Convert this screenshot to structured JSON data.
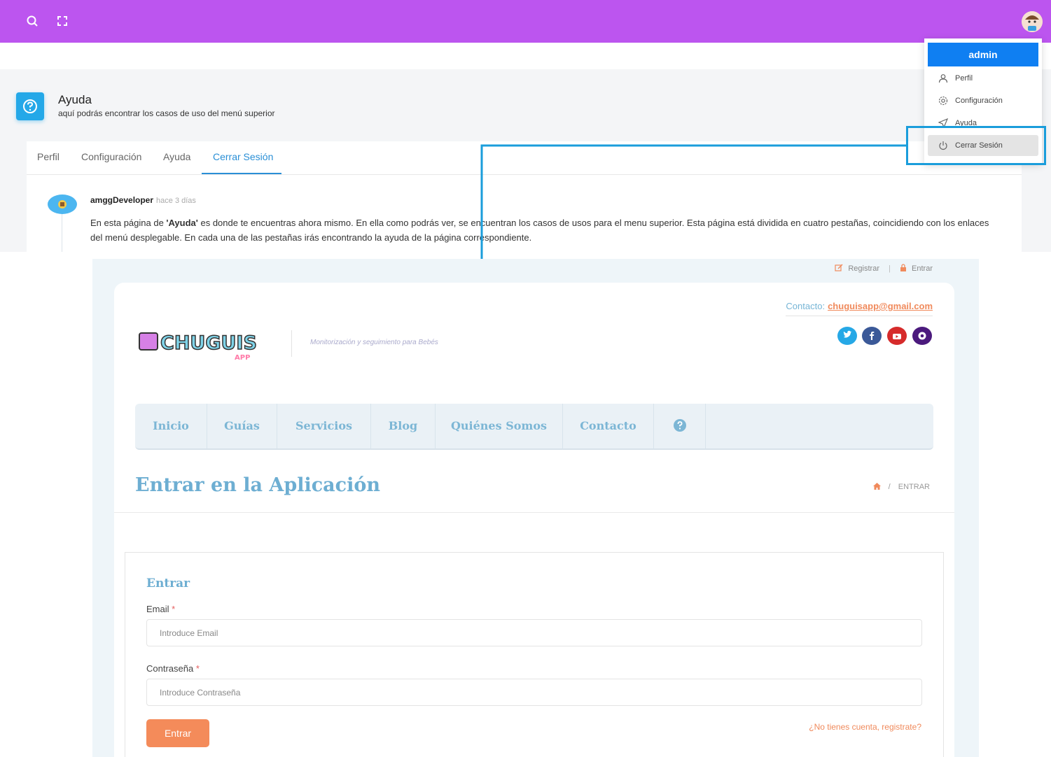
{
  "topbar": {
    "color": "#bc55ef"
  },
  "dropdown": {
    "header": "admin",
    "items": [
      {
        "label": "Perfil",
        "icon": "user-icon"
      },
      {
        "label": "Configuración",
        "icon": "gear-icon"
      },
      {
        "label": "Ayuda",
        "icon": "send-icon"
      },
      {
        "label": "Cerrar Sesión",
        "icon": "power-icon"
      }
    ]
  },
  "help": {
    "title": "Ayuda",
    "subtitle": "aquí podrás encontrar los casos de uso del menú superior"
  },
  "tabs": [
    {
      "label": "Perfil"
    },
    {
      "label": "Configuración"
    },
    {
      "label": "Ayuda"
    },
    {
      "label": "Cerrar Sesión"
    }
  ],
  "timeline": {
    "author": "amggDeveloper",
    "time": "hace 3 días",
    "text_pre": "En esta página de ",
    "text_bold": "'Ayuda'",
    "text_post": " es donde te encuentras ahora mismo. En ella como podrás ver, se encuentran los casos de usos para el menu superior. Esta página está dividida en cuatro pestañas, coincidiendo con los enlaces del menú desplegable. En cada una de las pestañas irás encontrando la ayuda de la página correspondiente."
  },
  "site": {
    "top_links": {
      "register": "Registrar",
      "login": "Entrar"
    },
    "contact_label": "Contacto:",
    "contact_email": "chuguisapp@gmail.com",
    "logo_text": "CHUGUIS",
    "logo_sub": "APP",
    "tagline": "Monitorización y seguimiento para Bebés",
    "social": [
      "twitter-icon",
      "facebook-icon",
      "youtube-icon",
      "github-icon"
    ],
    "nav": [
      "Inicio",
      "Guías",
      "Servicios",
      "Blog",
      "Quiénes Somos",
      "Contacto"
    ],
    "page_title": "Entrar en la Aplicación",
    "breadcrumb_current": "ENTRAR",
    "form": {
      "title": "Entrar",
      "email_label": "Email",
      "email_placeholder": "Introduce Email",
      "password_label": "Contraseña",
      "password_placeholder": "Introduce Contraseña",
      "required_mark": "*",
      "submit": "Entrar",
      "register_link": "¿No tienes cuenta, registrate?"
    }
  },
  "colors": {
    "accent_blue": "#1a9ddb",
    "site_orange": "#f48b5a",
    "site_blue": "#6daed2"
  }
}
